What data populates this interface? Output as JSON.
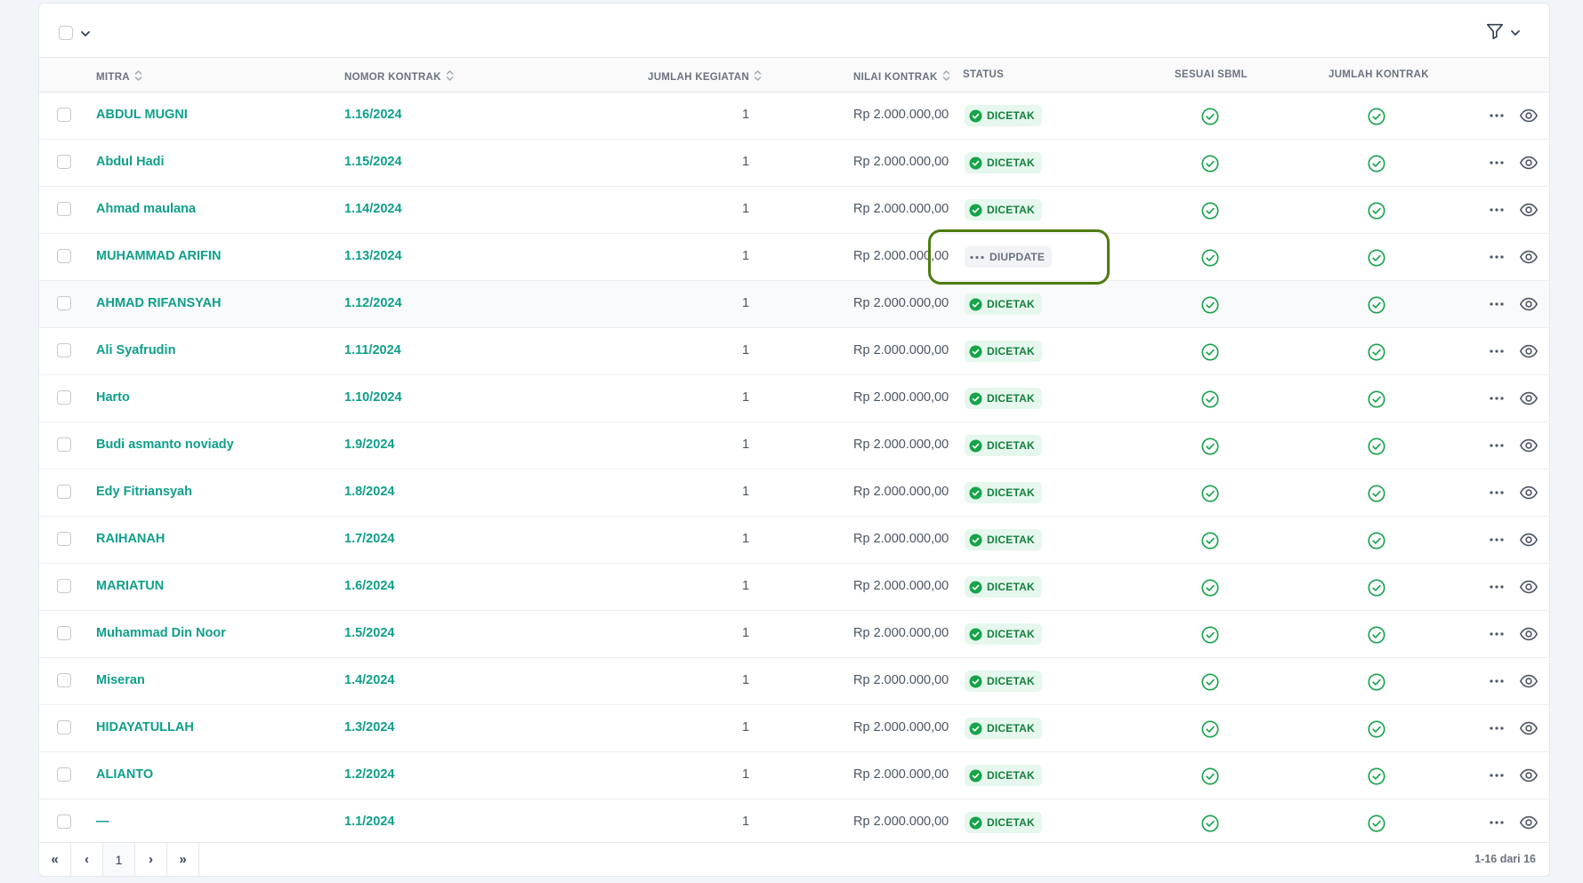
{
  "table": {
    "columns": {
      "mitra": "MITRA",
      "nomor": "NOMOR KONTRAK",
      "jumlah": "JUMLAH KEGIATAN",
      "nilai": "NILAI KONTRAK",
      "status": "STATUS",
      "sbml": "SESUAI SBML",
      "jumlah_kontrak": "JUMLAH KONTRAK"
    },
    "rows": [
      {
        "mitra": "ABDUL MUGNI",
        "nomor": "1.16/2024",
        "jumlah": "1",
        "nilai": "Rp 2.000.000,00",
        "status": "DICETAK",
        "status_type": "ok"
      },
      {
        "mitra": "Abdul Hadi",
        "nomor": "1.15/2024",
        "jumlah": "1",
        "nilai": "Rp 2.000.000,00",
        "status": "DICETAK",
        "status_type": "ok"
      },
      {
        "mitra": "Ahmad maulana",
        "nomor": "1.14/2024",
        "jumlah": "1",
        "nilai": "Rp 2.000.000,00",
        "status": "DICETAK",
        "status_type": "ok"
      },
      {
        "mitra": "MUHAMMAD ARIFIN",
        "nomor": "1.13/2024",
        "jumlah": "1",
        "nilai": "Rp 2.000.000,00",
        "status": "DIUPDATE",
        "status_type": "upd"
      },
      {
        "mitra": "AHMAD RIFANSYAH",
        "nomor": "1.12/2024",
        "jumlah": "1",
        "nilai": "Rp 2.000.000,00",
        "status": "DICETAK",
        "status_type": "ok"
      },
      {
        "mitra": "Ali Syafrudin",
        "nomor": "1.11/2024",
        "jumlah": "1",
        "nilai": "Rp 2.000.000,00",
        "status": "DICETAK",
        "status_type": "ok"
      },
      {
        "mitra": "Harto",
        "nomor": "1.10/2024",
        "jumlah": "1",
        "nilai": "Rp 2.000.000,00",
        "status": "DICETAK",
        "status_type": "ok"
      },
      {
        "mitra": "Budi asmanto noviady",
        "nomor": "1.9/2024",
        "jumlah": "1",
        "nilai": "Rp 2.000.000,00",
        "status": "DICETAK",
        "status_type": "ok"
      },
      {
        "mitra": "Edy Fitriansyah",
        "nomor": "1.8/2024",
        "jumlah": "1",
        "nilai": "Rp 2.000.000,00",
        "status": "DICETAK",
        "status_type": "ok"
      },
      {
        "mitra": "RAIHANAH",
        "nomor": "1.7/2024",
        "jumlah": "1",
        "nilai": "Rp 2.000.000,00",
        "status": "DICETAK",
        "status_type": "ok"
      },
      {
        "mitra": "MARIATUN",
        "nomor": "1.6/2024",
        "jumlah": "1",
        "nilai": "Rp 2.000.000,00",
        "status": "DICETAK",
        "status_type": "ok"
      },
      {
        "mitra": "Muhammad Din Noor",
        "nomor": "1.5/2024",
        "jumlah": "1",
        "nilai": "Rp 2.000.000,00",
        "status": "DICETAK",
        "status_type": "ok"
      },
      {
        "mitra": "Miseran",
        "nomor": "1.4/2024",
        "jumlah": "1",
        "nilai": "Rp 2.000.000,00",
        "status": "DICETAK",
        "status_type": "ok"
      },
      {
        "mitra": "HIDAYATULLAH",
        "nomor": "1.3/2024",
        "jumlah": "1",
        "nilai": "Rp 2.000.000,00",
        "status": "DICETAK",
        "status_type": "ok"
      },
      {
        "mitra": "ALIANTO",
        "nomor": "1.2/2024",
        "jumlah": "1",
        "nilai": "Rp 2.000.000,00",
        "status": "DICETAK",
        "status_type": "ok"
      },
      {
        "mitra": "—",
        "nomor": "1.1/2024",
        "jumlah": "1",
        "nilai": "Rp 2.000.000,00",
        "status": "DICETAK",
        "status_type": "ok"
      }
    ]
  },
  "pagination": {
    "first": "«",
    "prev": "‹",
    "page": "1",
    "next": "›",
    "last": "»",
    "range": "1-16 dari 16"
  },
  "colors": {
    "accent": "#0f9f8a",
    "status_ok_bg": "#e6f7ee",
    "status_ok_text": "#15803d",
    "highlight": "#4d7c0f"
  },
  "icons": {
    "filter": "filter-icon",
    "chevron": "chevron-down-icon",
    "check": "check-circle-icon",
    "more": "more-horizontal-icon",
    "view": "eye-icon"
  }
}
